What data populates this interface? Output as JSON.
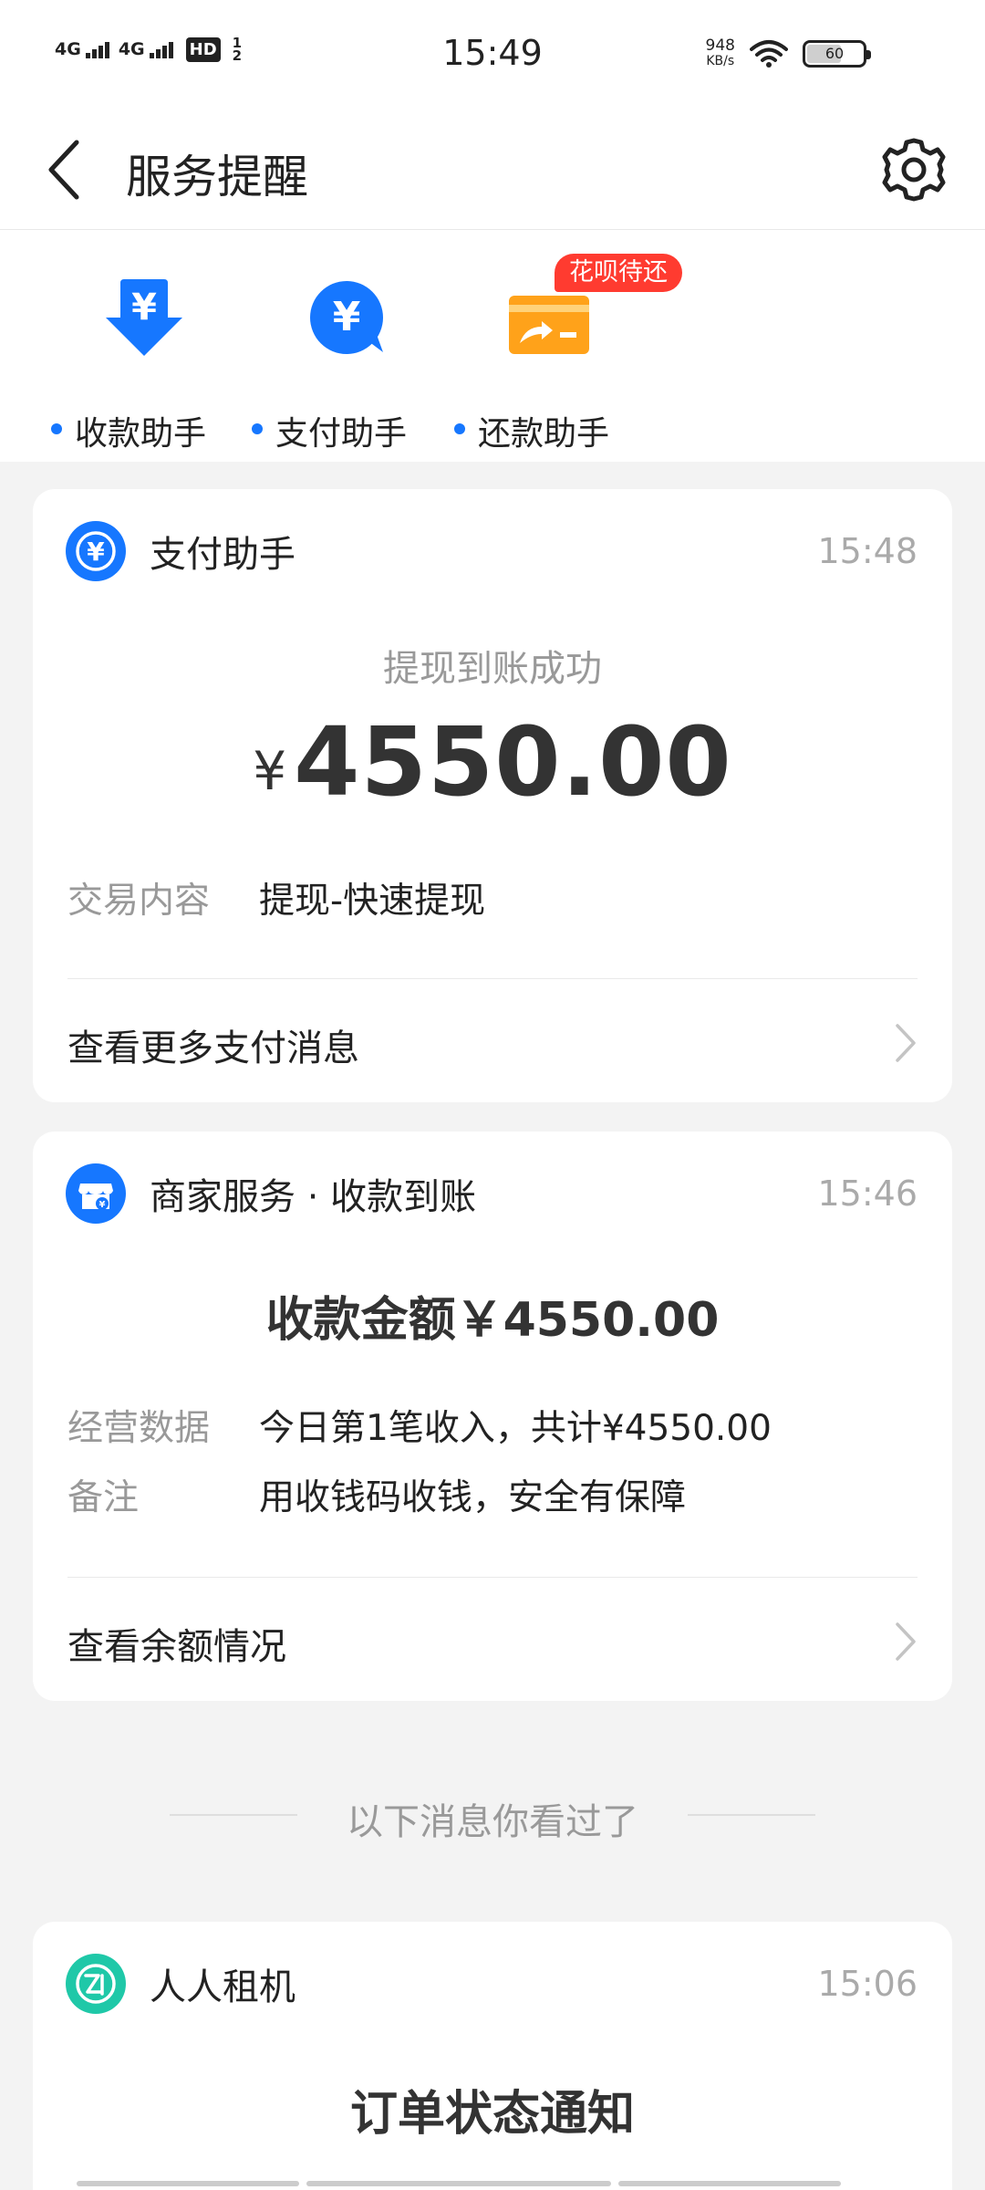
{
  "status_bar": {
    "network1": "4G",
    "network2": "4G",
    "hd_label": "HD",
    "hd_sub": "1 2",
    "time": "15:49",
    "net_speed_value": "948",
    "net_speed_unit": "KB/s",
    "battery_level": "60"
  },
  "nav": {
    "title": "服务提醒"
  },
  "assistants": [
    {
      "label": "收款助手",
      "icon": "receive-download-yen-icon"
    },
    {
      "label": "支付助手",
      "icon": "payment-chat-yen-icon"
    },
    {
      "label": "还款助手",
      "icon": "repayment-card-icon"
    }
  ],
  "repay_badge": "花呗待还",
  "card_payment": {
    "name": "支付助手",
    "time": "15:48",
    "subtitle": "提现到账成功",
    "currency": "¥",
    "amount": "4550.00",
    "detail_key": "交易内容",
    "detail_value": "提现-快速提现",
    "link": "查看更多支付消息"
  },
  "card_merchant": {
    "name": "商家服务 · 收款到账",
    "time": "15:46",
    "amount_line": "收款金额￥4550.00",
    "rows": [
      {
        "key": "经营数据",
        "value": "今日第1笔收入，共计¥4550.00"
      },
      {
        "key": "备注",
        "value": "用收钱码收钱，安全有保障"
      }
    ],
    "link": "查看余额情况"
  },
  "seen_separator": "以下消息你看过了",
  "card_rental": {
    "name": "人人租机",
    "time": "15:06",
    "title": "订单状态通知"
  },
  "colors": {
    "accent": "#1677ff",
    "badge": "#ff3b30",
    "card_orange": "#ffa21a",
    "rental_green": "#1fc8a8"
  }
}
